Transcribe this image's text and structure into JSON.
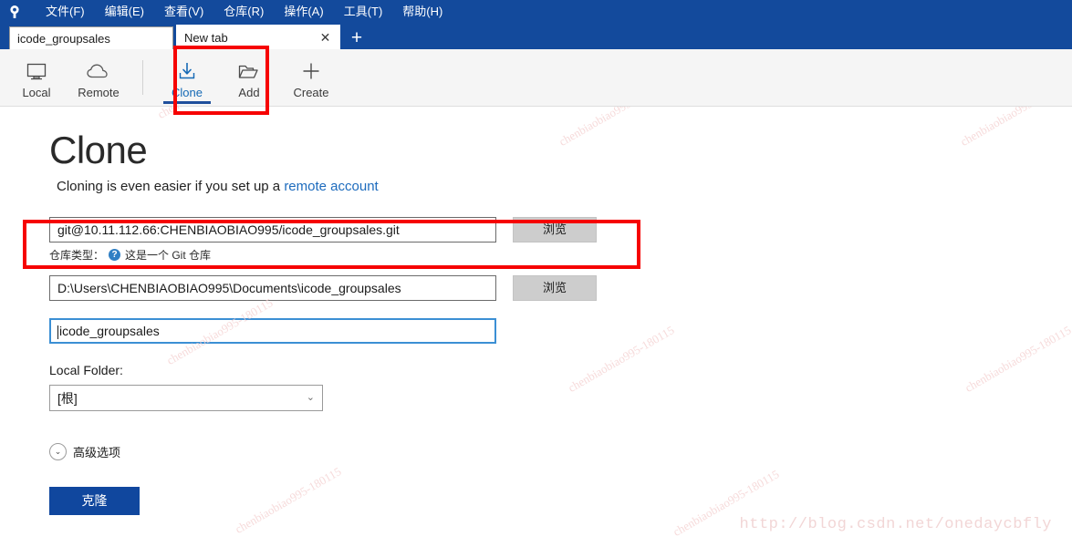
{
  "window": {
    "app_icon": "sourcetree-logo-icon",
    "menu": [
      {
        "label": "文件(F)",
        "name": "menu-file"
      },
      {
        "label": "编辑(E)",
        "name": "menu-edit"
      },
      {
        "label": "查看(V)",
        "name": "menu-view"
      },
      {
        "label": "仓库(R)",
        "name": "menu-repository"
      },
      {
        "label": "操作(A)",
        "name": "menu-actions"
      },
      {
        "label": "工具(T)",
        "name": "menu-tools"
      },
      {
        "label": "帮助(H)",
        "name": "menu-help"
      }
    ]
  },
  "tabs": {
    "items": [
      {
        "label": "icode_groupsales",
        "active": false,
        "closable": false
      },
      {
        "label": "New tab",
        "active": true,
        "closable": true
      }
    ],
    "close_glyph": "✕",
    "add_glyph": "+"
  },
  "toolbar": {
    "buttons": [
      {
        "label": "Local",
        "icon": "monitor-icon",
        "selected": false
      },
      {
        "label": "Remote",
        "icon": "cloud-icon",
        "selected": false
      },
      {
        "label": "Clone",
        "icon": "download-icon",
        "selected": true
      },
      {
        "label": "Add",
        "icon": "open-folder-icon",
        "selected": false
      },
      {
        "label": "Create",
        "icon": "plus-icon",
        "selected": false
      }
    ]
  },
  "main": {
    "title": "Clone",
    "subtitle_prefix": "Cloning is even easier if you set up a ",
    "subtitle_link": "remote account",
    "source_url": {
      "value": "git@10.11.112.66:CHENBIAOBIAO995/icode_groupsales.git",
      "browse_label": "浏览"
    },
    "repo_type_hint": {
      "label": "仓库类型：",
      "icon": "help-question-icon",
      "icon_glyph": "?",
      "text": "这是一个 Git 仓库"
    },
    "destination_path": {
      "value": "D:\\Users\\CHENBIAOBIAO995\\Documents\\icode_groupsales",
      "browse_label": "浏览"
    },
    "repo_name": {
      "value": "icode_groupsales",
      "focused": true
    },
    "local_folder": {
      "label": "Local Folder:",
      "selected": "[根]",
      "chevron_glyph": "⌄"
    },
    "advanced_options": {
      "label": "高级选项",
      "chevron_glyph": "⌄"
    },
    "clone_button": "克隆"
  },
  "annotations": {
    "color": "#f60202",
    "boxes": [
      "clone-toolbar-button",
      "source-url-field"
    ]
  },
  "watermarks": {
    "diagonal_text": "chenbiaobiao995-180115",
    "blog_url": "http://blog.csdn.net/onedaycbfly"
  },
  "colors": {
    "titlebar_blue": "#134a9c",
    "accent_blue": "#1569b5",
    "button_blue": "#10479e",
    "annotation_red": "#f60202",
    "toolbar_bg": "#f5f5f5"
  }
}
